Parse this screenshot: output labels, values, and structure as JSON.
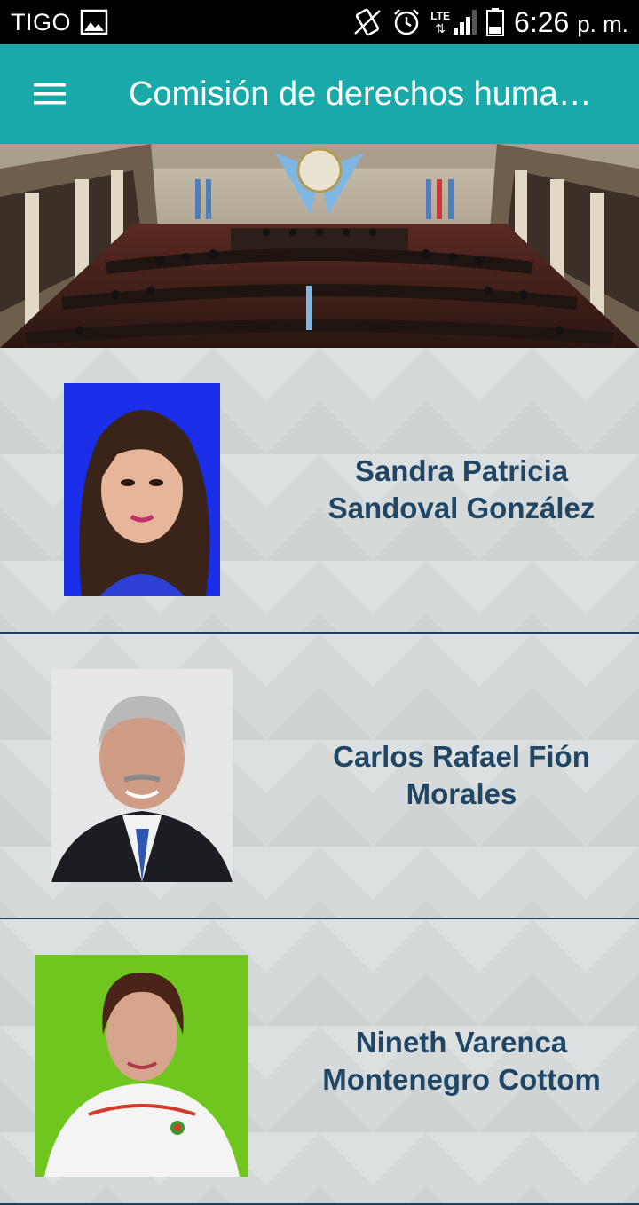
{
  "status_bar": {
    "carrier": "TIGO",
    "network": "LTE",
    "time": "6:26",
    "ampm": "p. m."
  },
  "app_bar": {
    "title": "Comisión de derechos huma…"
  },
  "members": [
    {
      "name": "Sandra Patricia Sandoval González"
    },
    {
      "name": "Carlos Rafael Fión Morales"
    },
    {
      "name": "Nineth Varenca Montenegro Cottom"
    }
  ],
  "colors": {
    "app_bar": "#1aa9a9",
    "name_text": "#1f4664",
    "divider": "#1e3f5a"
  }
}
